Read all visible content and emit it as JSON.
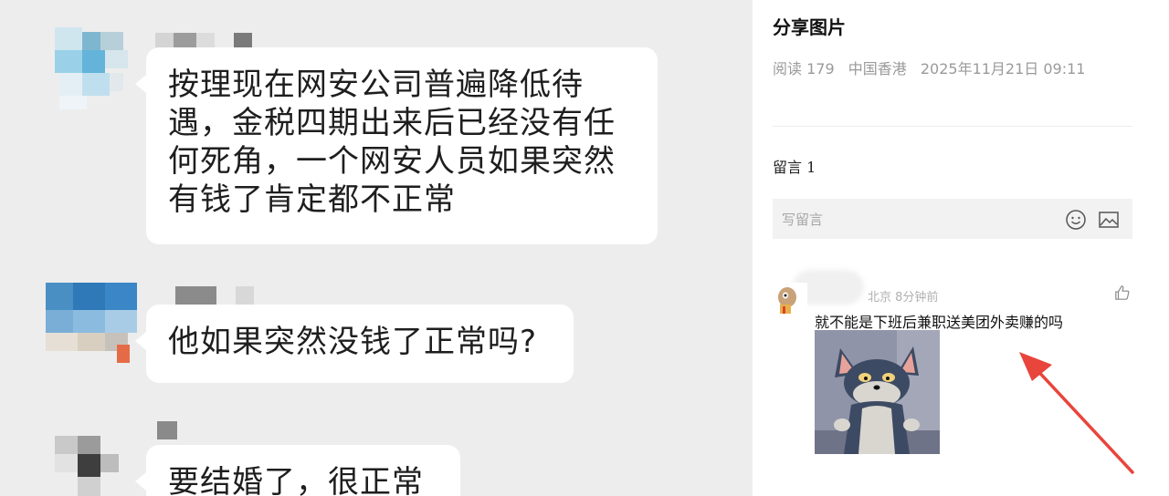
{
  "chat": {
    "messages": [
      {
        "text_lines": [
          "按理现在网安公司普遍降低待",
          "遇，金税四期出来后已经没有任",
          "何死角，一个网安人员如果突然",
          "有钱了肯定都不正常"
        ]
      },
      {
        "text_lines": [
          "他如果突然没钱了正常吗?"
        ]
      },
      {
        "text_lines": [
          "要结婚了，很正常"
        ]
      }
    ]
  },
  "post": {
    "title": "分享图片",
    "meta": {
      "reads": "阅读 179",
      "location": "中国香港",
      "datetime": "2025年11月21日 09:11"
    }
  },
  "comments": {
    "count_label": "留言 1",
    "input_placeholder": "写留言",
    "items": [
      {
        "location_time": "北京 8分钟前",
        "text": "就不能是下班后兼职送美团外卖赚的吗"
      }
    ]
  },
  "colors": {
    "chat_bg": "#ededed",
    "bubble": "#ffffff",
    "arrow": "#e8453c"
  },
  "icons": [
    "emoji-icon",
    "image-icon",
    "thumbs-up-icon"
  ]
}
